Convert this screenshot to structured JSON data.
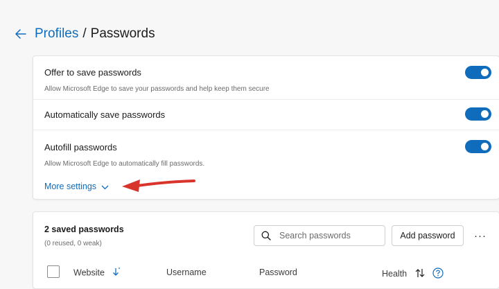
{
  "header": {
    "back_icon": "back-arrow-icon",
    "breadcrumb_parent": "Profiles",
    "breadcrumb_separator": "/",
    "breadcrumb_current": "Passwords"
  },
  "settings": {
    "offer_save": {
      "title": "Offer to save passwords",
      "description": "Allow Microsoft Edge to save your passwords and help keep them secure",
      "enabled": true
    },
    "auto_save": {
      "title": "Automatically save passwords",
      "enabled": true
    },
    "autofill": {
      "title": "Autofill passwords",
      "description": "Allow Microsoft Edge to automatically fill passwords.",
      "enabled": true
    },
    "more_settings_label": "More settings"
  },
  "saved": {
    "title": "2 saved passwords",
    "subtitle": "(0 reused, 0 weak)",
    "search_placeholder": "Search passwords",
    "add_label": "Add password",
    "more_label": "···",
    "columns": [
      "Website",
      "Username",
      "Password",
      "Health"
    ]
  },
  "colors": {
    "accent": "#0f6cbd",
    "annotation_arrow": "#d9342b"
  }
}
